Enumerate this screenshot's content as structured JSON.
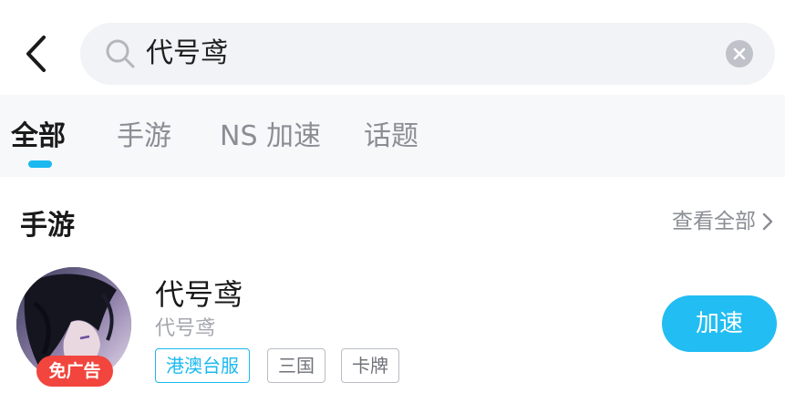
{
  "search": {
    "query": "代号鸢"
  },
  "tabs": [
    {
      "label": "全部",
      "active": true
    },
    {
      "label": "手游",
      "active": false
    },
    {
      "label": "NS 加速",
      "active": false
    },
    {
      "label": "话题",
      "active": false
    }
  ],
  "section": {
    "title": "手游",
    "see_all": "查看全部"
  },
  "game": {
    "name": "代号鸢",
    "subtitle": "代号鸢",
    "badge": "免广告",
    "tags": [
      "港澳台服",
      "三国",
      "卡牌"
    ],
    "button": "加速"
  },
  "colors": {
    "accent": "#1bb9ef",
    "button": "#22bdf2",
    "badge": "#f1453d",
    "tab_bar_bg": "#f7f8fa",
    "search_bg": "#f2f3f6"
  },
  "icons": {
    "back": "chevron-left-icon",
    "search": "search-icon",
    "clear": "clear-icon",
    "see_all": "chevron-right-icon"
  }
}
